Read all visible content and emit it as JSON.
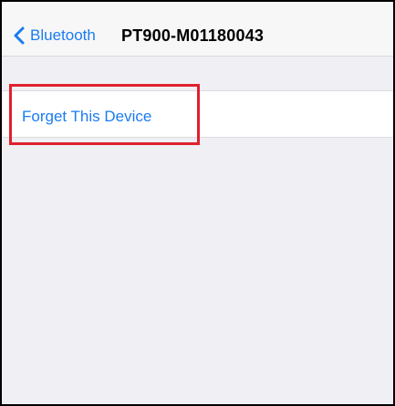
{
  "nav": {
    "back_label": "Bluetooth",
    "back_icon": "chevron-left-icon",
    "title": "PT900-M01180043"
  },
  "device_actions": {
    "forget_label": "Forget This Device"
  },
  "colors": {
    "accent": "#1a7cf0",
    "highlight": "#e0202e",
    "background": "#efeff4"
  }
}
